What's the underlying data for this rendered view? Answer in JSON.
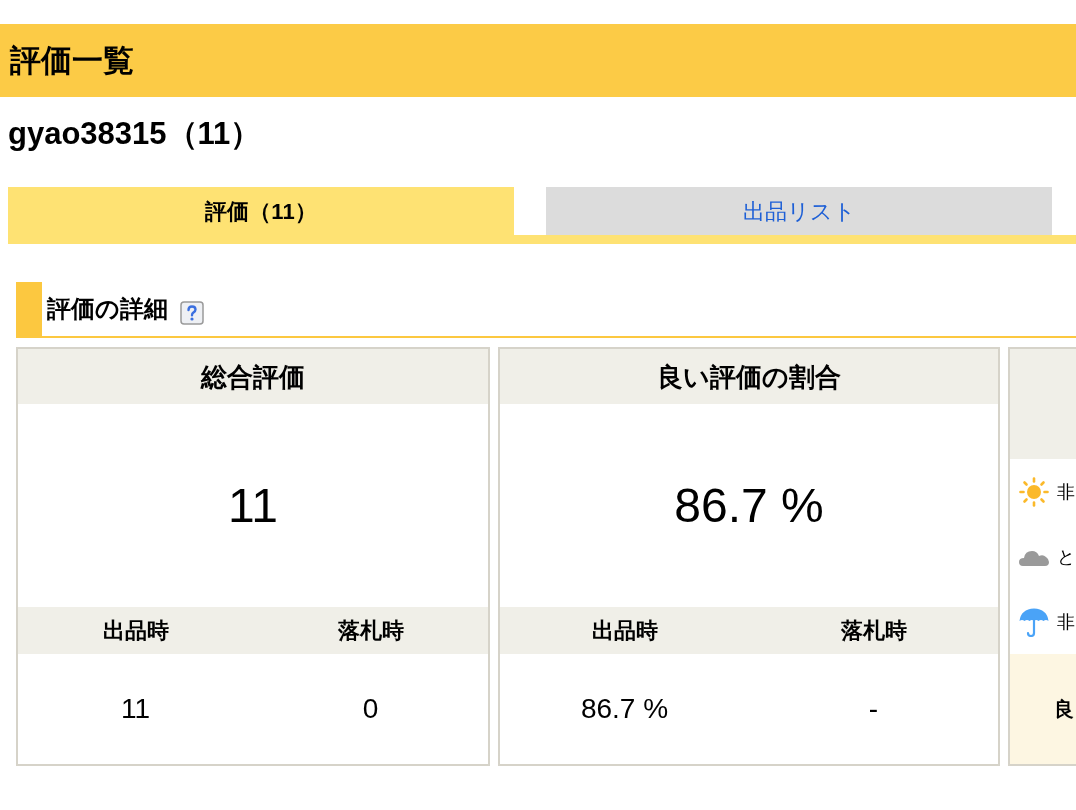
{
  "page": {
    "title": "評価一覧",
    "user": "gyao38315（11）"
  },
  "tabs": [
    {
      "label": "評価（11）",
      "selected": true
    },
    {
      "label": "出品リスト",
      "selected": false
    }
  ],
  "section": {
    "title": "評価の詳細"
  },
  "cards": [
    {
      "kind": "stat",
      "title": "総合評価",
      "value": "11",
      "columns": [
        {
          "label": "出品時",
          "value": "11"
        },
        {
          "label": "落札時",
          "value": "0"
        }
      ]
    },
    {
      "kind": "stat",
      "title": "良い評価の割合",
      "value": "86.7 %",
      "columns": [
        {
          "label": "出品時",
          "value": "86.7 %"
        },
        {
          "label": "落札時",
          "value": "-"
        }
      ]
    },
    {
      "kind": "breakdown",
      "rows": [
        {
          "kind": "good",
          "label": "非"
        },
        {
          "kind": "neutral",
          "label": "と"
        },
        {
          "kind": "bad",
          "label": "非"
        }
      ],
      "footer": "良"
    }
  ]
}
